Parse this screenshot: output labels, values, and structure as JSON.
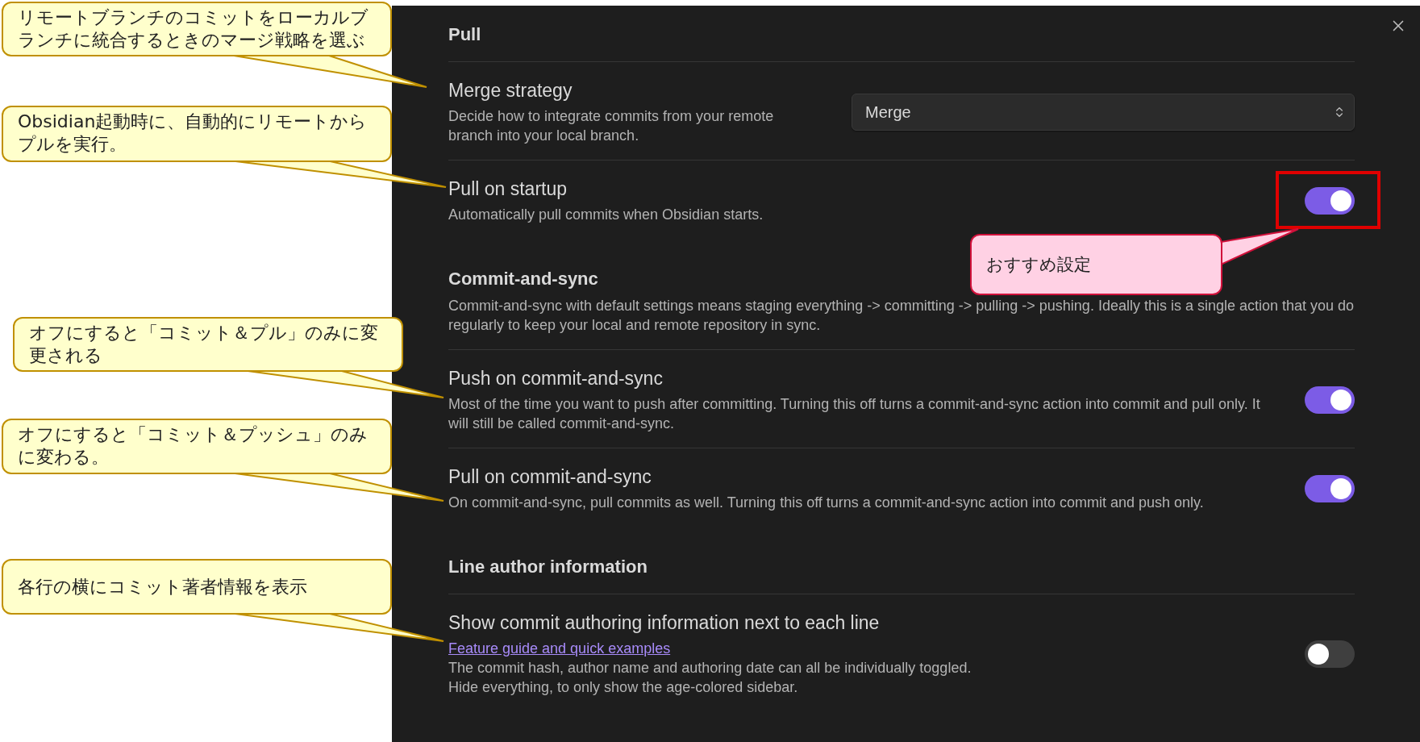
{
  "annotations": [
    {
      "kind": "note",
      "text": "リモートブランチのコミットをローカルブランチに統合するときのマージ戦略を選ぶ"
    },
    {
      "kind": "note",
      "text": "Obsidian起動時に、自動的にリモートからプルを実行。"
    },
    {
      "kind": "note",
      "text": "オフにすると「コミット＆プル」のみに変更される"
    },
    {
      "kind": "note",
      "text": "オフにすると「コミット＆プッシュ」のみに変わる。"
    },
    {
      "kind": "note",
      "text": "各行の横にコミット著者情報を表示"
    },
    {
      "kind": "recommend",
      "text": "おすすめ設定"
    }
  ],
  "settings": {
    "sections": [
      {
        "heading": "Pull",
        "items": [
          {
            "kind": "select",
            "title": "Merge strategy",
            "descriptions": [
              "Decide how to integrate commits from your remote branch into your local branch."
            ],
            "value": "Merge"
          },
          {
            "kind": "toggle",
            "title": "Pull on startup",
            "descriptions": [
              "Automatically pull commits when Obsidian starts."
            ],
            "on": true,
            "highlighted": true
          }
        ]
      },
      {
        "heading": "Commit-and-sync",
        "description": "Commit-and-sync with default settings means staging everything -> committing -> pulling -> pushing. Ideally this is a single action that you do regularly to keep your local and remote repository in sync.",
        "items": [
          {
            "kind": "toggle",
            "title": "Push on commit-and-sync",
            "descriptions": [
              "Most of the time you want to push after committing. Turning this off turns a commit-and-sync action into commit and pull only. It will still be called commit-and-sync."
            ],
            "on": true
          },
          {
            "kind": "toggle",
            "title": "Pull on commit-and-sync",
            "descriptions": [
              "On commit-and-sync, pull commits as well. Turning this off turns a commit-and-sync action into commit and push only."
            ],
            "on": true
          }
        ]
      },
      {
        "heading": "Line author information",
        "items": [
          {
            "kind": "toggle",
            "title": "Show commit authoring information next to each line",
            "link": "Feature guide and quick examples",
            "descriptions": [
              "The commit hash, author name and authoring date can all be individually toggled.",
              "Hide everything, to only show the age-colored sidebar."
            ],
            "on": false
          }
        ]
      }
    ]
  }
}
